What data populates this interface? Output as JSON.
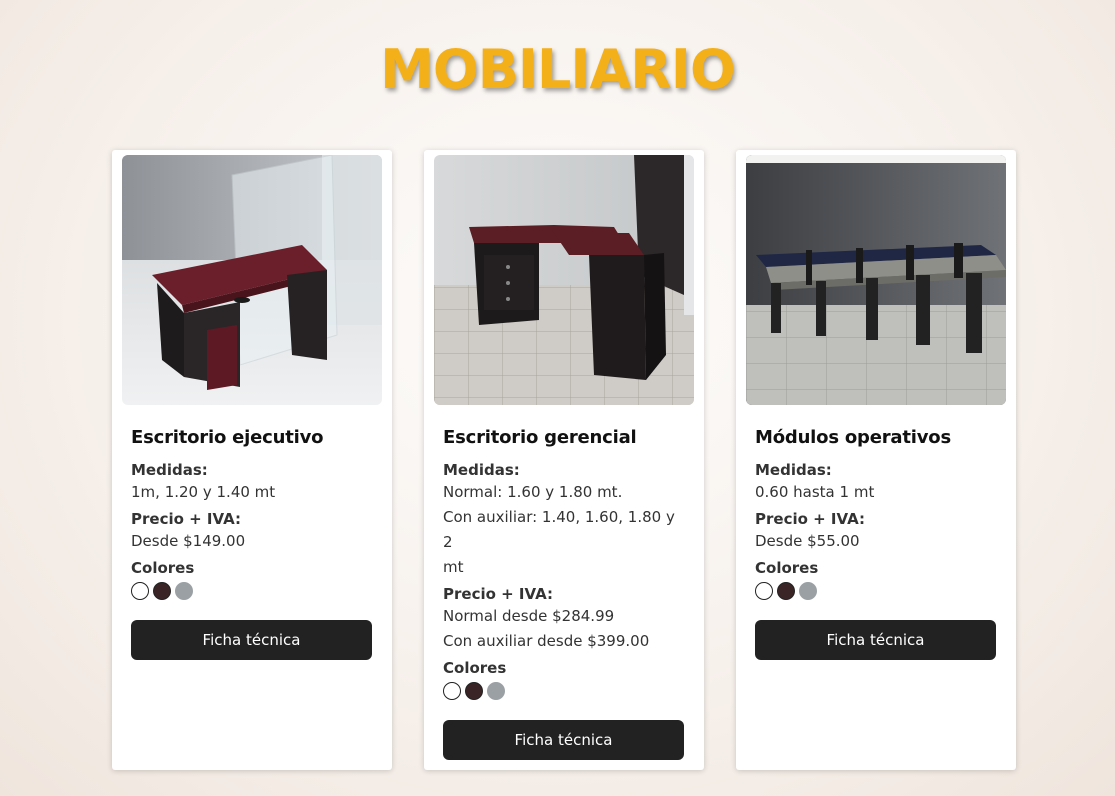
{
  "page": {
    "title": "MOBILIARIO",
    "title_color": "#f4b019"
  },
  "colors": {
    "white": "#ffffff",
    "dark_brown": "#3b2426",
    "gray": "#9aa0a4",
    "button_bg": "#222222"
  },
  "products": [
    {
      "name": "Escritorio ejecutivo",
      "medidas_label": "Medidas:",
      "medidas_lines": [
        "1m, 1.20 y 1.40 mt"
      ],
      "precio_label": "Precio + IVA:",
      "precio_lines": [
        "Desde $149.00"
      ],
      "colores_label": "Colores",
      "colores": [
        "#ffffff",
        "#3b2426",
        "#9aa0a4"
      ],
      "button_label": "Ficha técnica",
      "photo_icon": "executive-desk-photo"
    },
    {
      "name": "Escritorio gerencial",
      "medidas_label": "Medidas:",
      "medidas_lines": [
        "Normal: 1.60 y 1.80 mt.",
        "Con auxiliar: 1.40, 1.60, 1.80 y 2",
        "mt"
      ],
      "precio_label": "Precio + IVA:",
      "precio_lines": [
        "Normal desde $284.99",
        "Con auxiliar desde $399.00"
      ],
      "colores_label": "Colores",
      "colores": [
        "#ffffff",
        "#3b2426",
        "#9aa0a4"
      ],
      "button_label": "Ficha técnica",
      "photo_icon": "managerial-desk-photo"
    },
    {
      "name": "Módulos operativos",
      "medidas_label": "Medidas:",
      "medidas_lines": [
        "0.60 hasta 1 mt"
      ],
      "precio_label": "Precio + IVA:",
      "precio_lines": [
        "Desde $55.00"
      ],
      "colores_label": "Colores",
      "colores": [
        "#ffffff",
        "#3b2426",
        "#9aa0a4"
      ],
      "button_label": "Ficha técnica",
      "photo_icon": "operative-modules-photo"
    }
  ]
}
